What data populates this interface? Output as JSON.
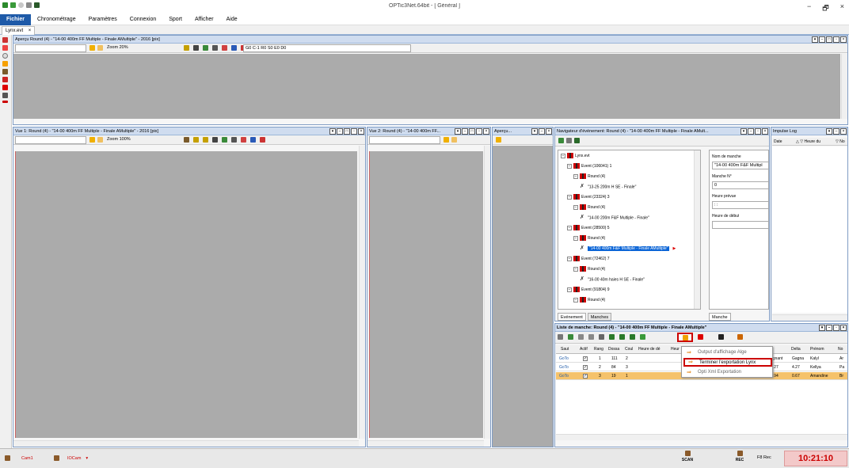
{
  "window": {
    "title": "OPTic3Net.64bit - [ Général ]",
    "min": "−",
    "max": "🗗",
    "close": "×"
  },
  "menu": [
    "Fichier",
    "Chronométrage",
    "Paramètres",
    "Connexion",
    "Sport",
    "Afficher",
    "Aide"
  ],
  "doc_tab": {
    "label": "Lynx.evt",
    "close": "×"
  },
  "preview": {
    "title": "Aperçu Round (4) - \"14-00 400m FF Multiple - Finale AMultiple\" - 2016 [pix]",
    "zoom": "Zoom 20%",
    "code": "G0 C-1 R0 S0 E0 D0"
  },
  "view1": {
    "title": "Vue 1: Round (4) - \"14-00 400m FF Multiple - Finale AMultiple\" - 2016 [pix]",
    "zoom": "Zoom 100%"
  },
  "view2": {
    "title": "Vue 2: Round (4) - \"14-00 400m FF..."
  },
  "apercu_small": {
    "title": "Aperçu..."
  },
  "navigator": {
    "title": "Navigateur d'événement: Round (4) - \"14-00 400m FF Multiple - Finale AMult...",
    "tree": [
      {
        "label": "Lynx.evt",
        "level": 0,
        "type": "flag"
      },
      {
        "label": "Event (106041) 1",
        "level": 1,
        "type": "flag"
      },
      {
        "label": "Round (4)",
        "level": 2,
        "type": "flag"
      },
      {
        "label": "\"13-25 200m H SE - Finale\"",
        "level": 3,
        "type": "runner"
      },
      {
        "label": "Event (23324) 3",
        "level": 1,
        "type": "flag"
      },
      {
        "label": "Round (4)",
        "level": 2,
        "type": "flag"
      },
      {
        "label": "\"14-00 200m F&F Multiple - Finale\"",
        "level": 3,
        "type": "runner"
      },
      {
        "label": "Event (28500) 5",
        "level": 1,
        "type": "flag"
      },
      {
        "label": "Round (4)",
        "level": 2,
        "type": "flag"
      },
      {
        "label": "\"14-00 400m F&F Multiple - Finale AMultiple\"",
        "level": 3,
        "type": "runner",
        "selected": true
      },
      {
        "label": "Event (72462) 7",
        "level": 1,
        "type": "flag"
      },
      {
        "label": "Round (4)",
        "level": 2,
        "type": "flag"
      },
      {
        "label": "\"16-00 40m haies H SE - Finale\"",
        "level": 3,
        "type": "runner"
      },
      {
        "label": "Event (91804) 9",
        "level": 1,
        "type": "flag"
      },
      {
        "label": "Round (4)",
        "level": 2,
        "type": "flag"
      }
    ],
    "tabs": [
      "Evénement",
      "Manches"
    ],
    "props": {
      "nom_label": "Nom de manche",
      "nom_value": "\"14-00 400m F&F Multipl",
      "manche_label": "Manche N°",
      "manche_value": "0",
      "heure_prevue_label": "Heure prévue",
      "heure_prevue_value": "  :  :",
      "heure_debut_label": "Heure de début",
      "heure_debut_value": ""
    },
    "prop_tab": "Manche"
  },
  "impulse": {
    "title": "Impulse Log",
    "cols": [
      "Date",
      "△ ▽ Heure du",
      "▽ No"
    ]
  },
  "liste": {
    "title": "Liste de manche: Round (4) - \"14-00 400m FF Multiple - Finale AMultiple\"",
    "headers": [
      "Saut",
      "Actif",
      "Rang",
      "Dossa",
      "Coul",
      "Heure de dé",
      "Heur"
    ],
    "right_headers": [
      "Delta",
      "Prénom",
      "No"
    ],
    "rows": [
      {
        "saut": "GoTo",
        "rang": "1",
        "dossa": "111",
        "coul": "2",
        "time": "",
        "gagnant": "agnant",
        "delta": "Gagna",
        "prenom": "Kalyl",
        "no": "Ar"
      },
      {
        "saut": "GoTo",
        "rang": "2",
        "dossa": "84",
        "coul": "3",
        "time": "",
        "gagnant": "4.27",
        "delta": "4.27",
        "prenom": "Kellya",
        "no": "Pa"
      },
      {
        "saut": "GoTo",
        "rang": "3",
        "dossa": "19",
        "coul": "1",
        "time": "59.54",
        "gagnant": "4.94",
        "delta": "0.67",
        "prenom": "Amandine",
        "no": "Br"
      }
    ]
  },
  "context_menu": {
    "items": [
      "Output d'affichage Alge",
      "Terminer l'exportation Lynx",
      "Opti Xml Exportation"
    ],
    "highlighted": 1
  },
  "status": {
    "cam1": "Cam1",
    "iocam": "IOCam",
    "scan": "SCAN",
    "rec": "REC",
    "f8": "F8 Rec",
    "clock": "10:21:10"
  },
  "colors": {
    "accent": "#1e5aa8",
    "panel_border": "#7f9cc4",
    "selected": "#0a64d6",
    "highlight_row": "#f5c26b",
    "clock_bg": "#f3c9c9",
    "red": "#cc0000"
  }
}
